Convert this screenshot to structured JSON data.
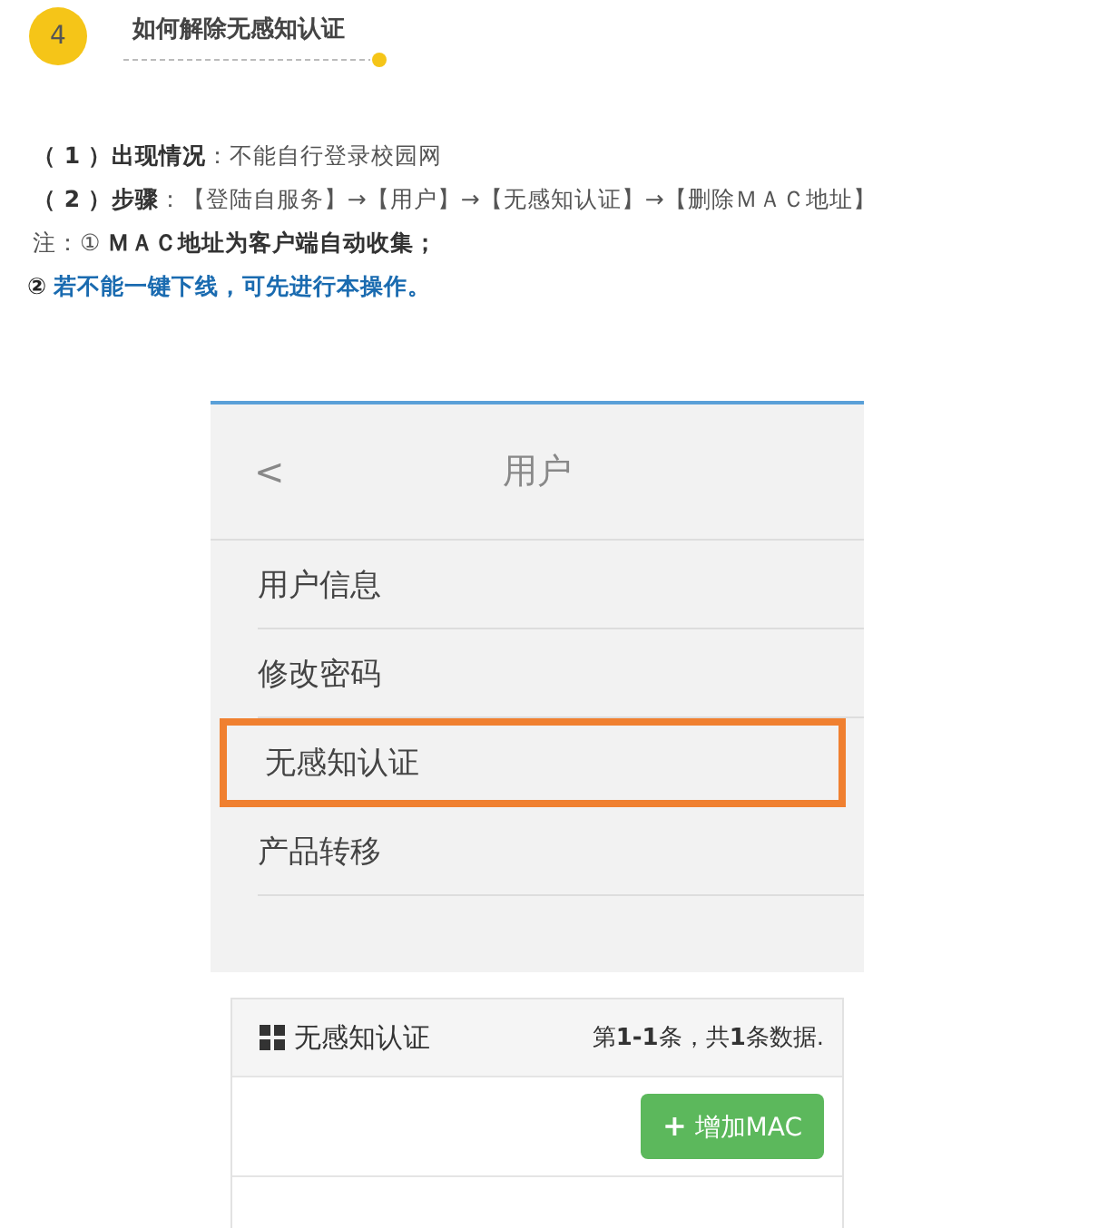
{
  "step": {
    "number": "4",
    "title": "如何解除无感知认证"
  },
  "lines": [
    {
      "kind": "plain",
      "text": "**（ 1 ）出现情况**：不能自行登录校园网"
    },
    {
      "kind": "plain",
      "text": "**（ 2 ）步骤**：【登陆自服务】→【用户】→【无感知认证】→【删除ＭＡＣ地址】"
    },
    {
      "kind": "plain",
      "text": "注：① **ＭＡＣ地址为客户端自动收集；**"
    },
    {
      "kind": "highlight",
      "marker": "②",
      "text": "若不能一键下线，可先进行本操作。"
    }
  ],
  "phone_screen": {
    "back": "<",
    "title": "用户",
    "items": [
      {
        "label": "用户信息",
        "highlighted": false
      },
      {
        "label": "修改密码",
        "highlighted": false
      },
      {
        "label": "无感知认证",
        "highlighted": true
      },
      {
        "label": "产品转移",
        "highlighted": false
      }
    ]
  },
  "panel": {
    "title": "无感知认证",
    "summary": "第**1-1**条，共**1**条数据.",
    "add_button": {
      "icon": "+",
      "label": "增加MAC"
    }
  }
}
